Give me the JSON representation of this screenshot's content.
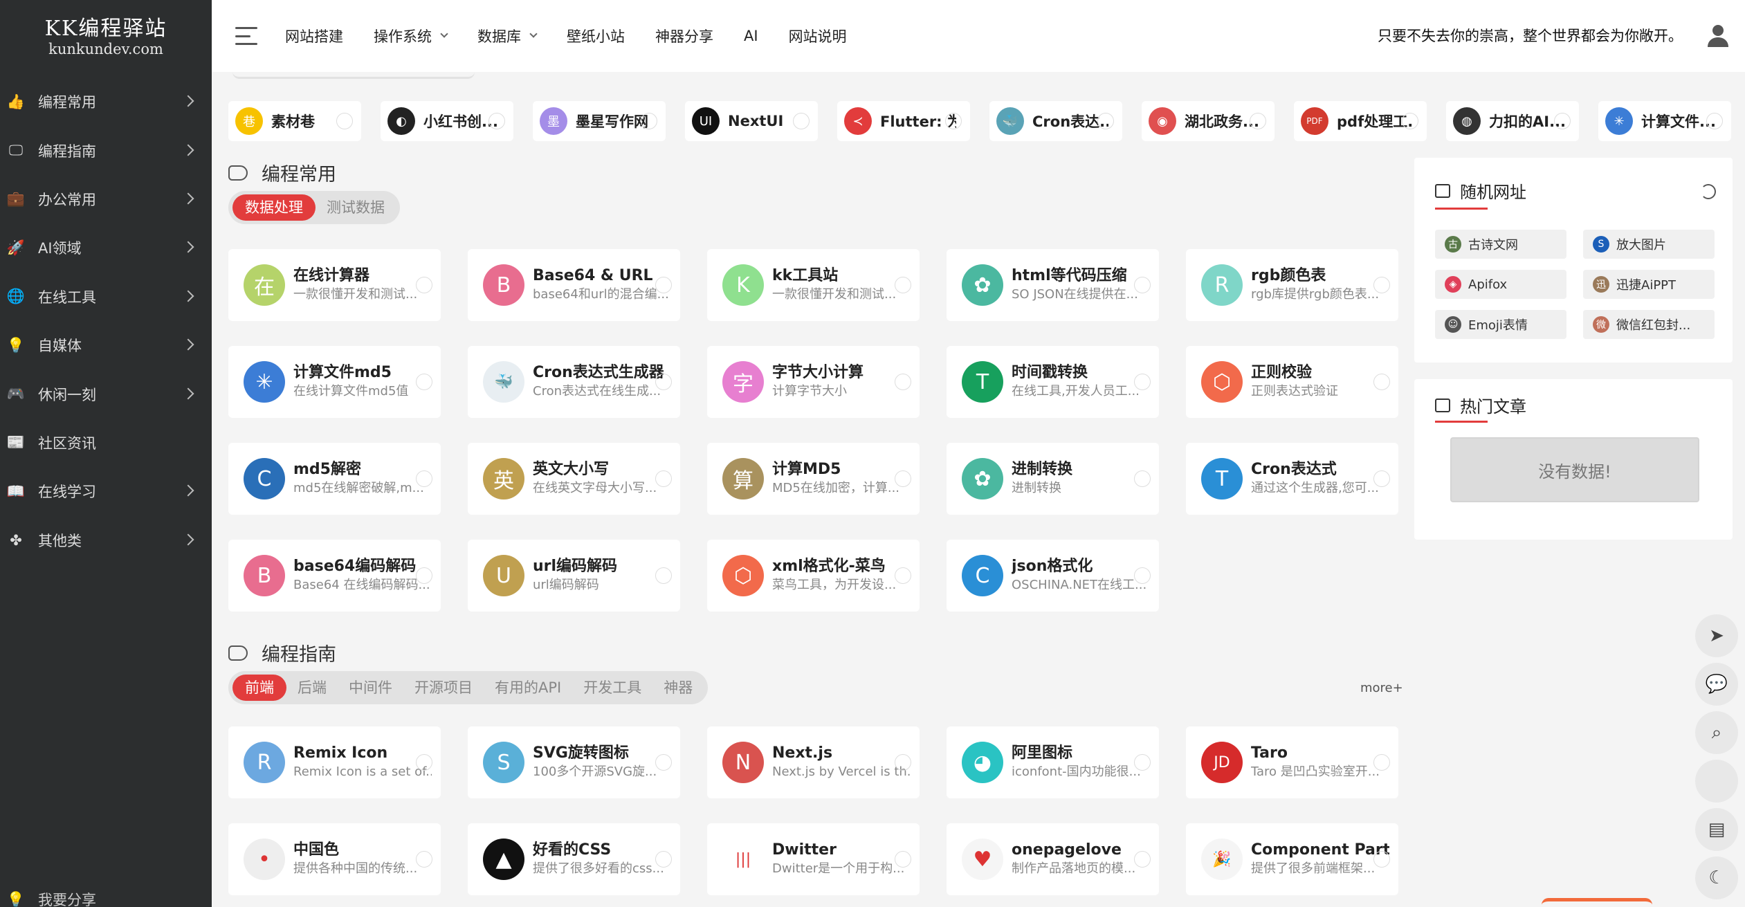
{
  "logo": {
    "line1": "KK编程驿站",
    "line2": "kunkundev.com"
  },
  "sidebar": {
    "items": [
      {
        "label": "编程常用",
        "icon": "thumbs-up-icon",
        "glyph": "👍",
        "has_arrow": true
      },
      {
        "label": "编程指南",
        "icon": "monitor-icon",
        "glyph": "🖵",
        "has_arrow": true
      },
      {
        "label": "办公常用",
        "icon": "briefcase-icon",
        "glyph": "💼",
        "has_arrow": true
      },
      {
        "label": "AI领域",
        "icon": "rocket-icon",
        "glyph": "🚀",
        "has_arrow": true
      },
      {
        "label": "在线工具",
        "icon": "globe-icon",
        "glyph": "🌐",
        "has_arrow": true
      },
      {
        "label": "自媒体",
        "icon": "lightbulb-icon",
        "glyph": "💡",
        "has_arrow": true
      },
      {
        "label": "休闲一刻",
        "icon": "gamepad-icon",
        "glyph": "🎮",
        "has_arrow": true
      },
      {
        "label": "社区资讯",
        "icon": "news-icon",
        "glyph": "📰",
        "has_arrow": false
      },
      {
        "label": "在线学习",
        "icon": "book-icon",
        "glyph": "📖",
        "has_arrow": true
      },
      {
        "label": "其他类",
        "icon": "apps-icon",
        "glyph": "✤",
        "has_arrow": true
      }
    ],
    "bottom_label": "我要分享"
  },
  "topbar": {
    "nav": [
      {
        "label": "网站搭建",
        "dropdown": false
      },
      {
        "label": "操作系统",
        "dropdown": true
      },
      {
        "label": "数据库",
        "dropdown": true
      },
      {
        "label": "壁纸小站",
        "dropdown": false
      },
      {
        "label": "神器分享",
        "dropdown": false
      },
      {
        "label": "AI",
        "dropdown": false
      },
      {
        "label": "网站说明",
        "dropdown": false
      }
    ],
    "motto": "只要不失去你的崇高，整个世界都会为你敞开。"
  },
  "shortcuts": [
    {
      "label": "素材巷",
      "glyph": "巷",
      "color": "#f7c200"
    },
    {
      "label": "小红书创...",
      "glyph": "◐",
      "color": "#222222"
    },
    {
      "label": "墨星写作网",
      "glyph": "墨",
      "color": "#a48de8"
    },
    {
      "label": "NextUI",
      "glyph": "UI",
      "color": "#111111"
    },
    {
      "label": "Flutter: 为...",
      "glyph": "≺",
      "color": "#e23c3c"
    },
    {
      "label": "Cron表达...",
      "glyph": "🐳",
      "color": "#5aa3b6"
    },
    {
      "label": "湖北政务...",
      "glyph": "◉",
      "color": "#e05050"
    },
    {
      "label": "pdf处理工...",
      "glyph": "PDF",
      "color": "#d33b2f"
    },
    {
      "label": "力扣的AI...",
      "glyph": "◍",
      "color": "#333333"
    },
    {
      "label": "计算文件...",
      "glyph": "✳",
      "color": "#3c7dd6"
    }
  ],
  "sections": [
    {
      "title": "编程常用",
      "tabs": [
        "数据处理",
        "测试数据"
      ],
      "active_tab": 0,
      "cards": [
        {
          "title": "在线计算器",
          "desc": "一款很懂开发和测试...",
          "glyph": "在",
          "color": "#b5d36a"
        },
        {
          "title": "Base64 & URL",
          "desc": "base64和url的混合编...",
          "glyph": "B",
          "color": "#e86d8f"
        },
        {
          "title": "kk工具站",
          "desc": "一款很懂开发和测试...",
          "glyph": "K",
          "color": "#8fe08f"
        },
        {
          "title": "html等代码压缩",
          "desc": "SO JSON在线提供在...",
          "glyph": "✿",
          "color": "#4bb8a0"
        },
        {
          "title": "rgb颜色表",
          "desc": "rgb库提供rgb颜色表...",
          "glyph": "R",
          "color": "#7fd6c8"
        },
        {
          "title": "计算文件md5",
          "desc": "在线计算文件md5值",
          "glyph": "✳",
          "color": "#3c7dd6"
        },
        {
          "title": "Cron表达式生成器",
          "desc": "Cron表达式在线生成...",
          "glyph": "🐳",
          "color": "#e8eef2"
        },
        {
          "title": "字节大小计算",
          "desc": "计算字节大小",
          "glyph": "字",
          "color": "#e77fd0"
        },
        {
          "title": "时间戳转换",
          "desc": "在线工具,开发人员工...",
          "glyph": "T",
          "color": "#17a05d"
        },
        {
          "title": "正则校验",
          "desc": "正则表达式验证",
          "glyph": "⬡",
          "color": "#f26a4b"
        },
        {
          "title": "md5解密",
          "desc": "md5在线解密破解,m...",
          "glyph": "C",
          "color": "#2a6fb8"
        },
        {
          "title": "英文大小写",
          "desc": "在线英文字母大小写...",
          "glyph": "英",
          "color": "#c0a050"
        },
        {
          "title": "计算MD5",
          "desc": "MD5在线加密，计算...",
          "glyph": "算",
          "color": "#a9925e"
        },
        {
          "title": "进制转换",
          "desc": "进制转换",
          "glyph": "✿",
          "color": "#4bb8a0"
        },
        {
          "title": "Cron表达式",
          "desc": "通过这个生成器,您可...",
          "glyph": "T",
          "color": "#2a8fd6"
        },
        {
          "title": "base64编码解码",
          "desc": "Base64 在线编码解码...",
          "glyph": "B",
          "color": "#e86d8f"
        },
        {
          "title": "url编码解码",
          "desc": "url编码解码",
          "glyph": "U",
          "color": "#c0a050"
        },
        {
          "title": "xml格式化-菜鸟",
          "desc": "菜鸟工具，为开发设...",
          "glyph": "⬡",
          "color": "#f26a4b"
        },
        {
          "title": "json格式化",
          "desc": "OSCHINA.NET在线工...",
          "glyph": "C",
          "color": "#2a8fd6"
        }
      ]
    },
    {
      "title": "编程指南",
      "tabs": [
        "前端",
        "后端",
        "中间件",
        "开源项目",
        "有用的API",
        "开发工具",
        "神器"
      ],
      "active_tab": 0,
      "more": "more+",
      "cards": [
        {
          "title": "Remix Icon",
          "desc": "Remix Icon is a set of...",
          "glyph": "R",
          "color": "#6ca8e0"
        },
        {
          "title": "SVG旋转图标",
          "desc": "100多个开源SVG旋...",
          "glyph": "S",
          "color": "#5ab0d8"
        },
        {
          "title": "Next.js",
          "desc": "Next.js by Vercel is th...",
          "glyph": "N",
          "color": "#d9534f"
        },
        {
          "title": "阿里图标",
          "desc": "iconfont-国内功能很...",
          "glyph": "◕",
          "color": "#2ac3c3"
        },
        {
          "title": "Taro",
          "desc": "Taro 是凹凸实验室开...",
          "glyph": "JD",
          "color": "#d62b2b"
        },
        {
          "title": "中国色",
          "desc": "提供各种中国的传统...",
          "glyph": "•",
          "color": "#eeeeee"
        },
        {
          "title": "好看的CSS",
          "desc": "提供了很多好看的css...",
          "glyph": "▲",
          "color": "#111111"
        },
        {
          "title": "Dwitter",
          "desc": "Dwitter是一个用于构...",
          "glyph": "|||",
          "color": "#ffffff"
        },
        {
          "title": "onepagelove",
          "desc": "制作产品落地页的模...",
          "glyph": "♥",
          "color": "#f5f5f5"
        },
        {
          "title": "Component Party",
          "desc": "提供了很多前端框架...",
          "glyph": "🎉",
          "color": "#f5f5f5"
        }
      ]
    }
  ],
  "random_sites": {
    "title": "随机网址",
    "items": [
      {
        "label": "古诗文网",
        "glyph": "古",
        "color": "#5a7a4a"
      },
      {
        "label": "放大图片",
        "glyph": "S",
        "color": "#1c5fb8"
      },
      {
        "label": "Apifox",
        "glyph": "◈",
        "color": "#e0405a"
      },
      {
        "label": "迅捷AiPPT",
        "glyph": "迅",
        "color": "#9a7a5a"
      },
      {
        "label": "Emoji表情",
        "glyph": "☺",
        "color": "#555555"
      },
      {
        "label": "微信红包封...",
        "glyph": "微",
        "color": "#c0705a"
      }
    ]
  },
  "hot_articles": {
    "title": "热门文章",
    "empty_text": "没有数据!"
  },
  "float_buttons": [
    {
      "icon": "arrow-up-icon",
      "glyph": "➤"
    },
    {
      "icon": "wechat-icon",
      "glyph": "💬"
    },
    {
      "icon": "search-icon",
      "glyph": "⌕"
    },
    {
      "icon": "blank-icon",
      "glyph": ""
    },
    {
      "icon": "calendar-icon",
      "glyph": "▤"
    },
    {
      "icon": "moon-icon",
      "glyph": "☾"
    }
  ]
}
